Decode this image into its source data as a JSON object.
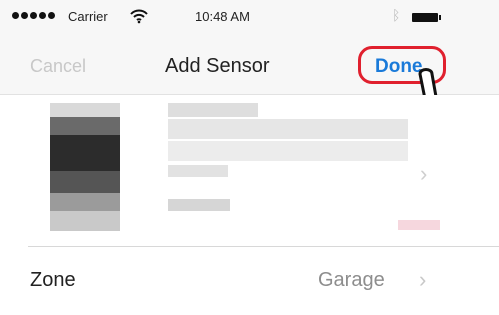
{
  "status_bar": {
    "carrier": "Carrier",
    "time": "10:48 AM",
    "signal_icon": "signal-dots-icon",
    "wifi_icon": "wifi-icon",
    "bluetooth_icon": "bluetooth-icon",
    "battery_icon": "battery-icon"
  },
  "navbar": {
    "cancel_label": "Cancel",
    "title": "Add Sensor",
    "done_label": "Done",
    "done_highlight_color": "#e0202e",
    "link_color": "#1a7ad9"
  },
  "sensor": {
    "thumbnail": "sensor-thumbnail-pixelated",
    "chevron_icon": "chevron-right-icon"
  },
  "zone_row": {
    "label": "Zone",
    "value": "Garage",
    "chevron_icon": "chevron-right-icon"
  },
  "overlay": {
    "icon": "pointing-hand-icon"
  }
}
